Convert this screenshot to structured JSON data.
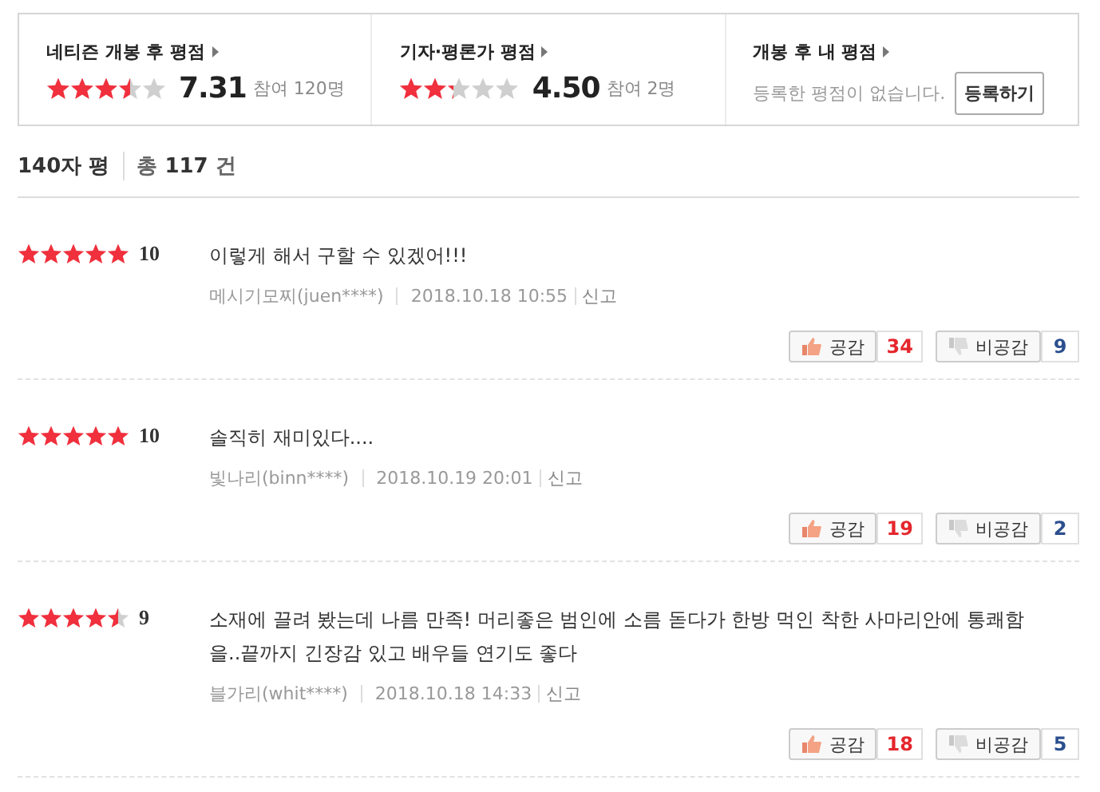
{
  "summary": [
    {
      "title": "네티즌 개봉 후 평점",
      "stars": 3.5,
      "score": "7.31",
      "count": "참여 120명"
    },
    {
      "title": "기자·평론가 평점",
      "stars": 2.25,
      "score": "4.50",
      "count": "참여 2명"
    },
    {
      "title": "개봉 후 내 평점",
      "empty_text": "등록한 평점이 없습니다.",
      "button": "등록하기"
    }
  ],
  "list_header": {
    "title": "140자 평",
    "total_label": "총",
    "total": "117",
    "unit": "건"
  },
  "reviews": [
    {
      "stars": 5,
      "score": "10",
      "text": "이렇게 해서 구할 수 있겠어!!!",
      "author": "메시기모찌(juen****)",
      "date": "2018.10.18 10:55",
      "report": "신고",
      "like_label": "공감",
      "likes": "34",
      "dislike_label": "비공감",
      "dislikes": "9"
    },
    {
      "stars": 5,
      "score": "10",
      "text": "솔직히 재미있다....",
      "author": "빛나리(binn****)",
      "date": "2018.10.19 20:01",
      "report": "신고",
      "like_label": "공감",
      "likes": "19",
      "dislike_label": "비공감",
      "dislikes": "2"
    },
    {
      "stars": 4.5,
      "score": "9",
      "text": "소재에 끌려 봤는데 나름 만족! 머리좋은 범인에 소름 돋다가 한방 먹인 착한 사마리안에 통쾌함을..끝까지 긴장감 있고 배우들 연기도 좋다",
      "author": "블가리(whit****)",
      "date": "2018.10.18 14:33",
      "report": "신고",
      "like_label": "공감",
      "likes": "18",
      "dislike_label": "비공감",
      "dislikes": "5"
    }
  ]
}
